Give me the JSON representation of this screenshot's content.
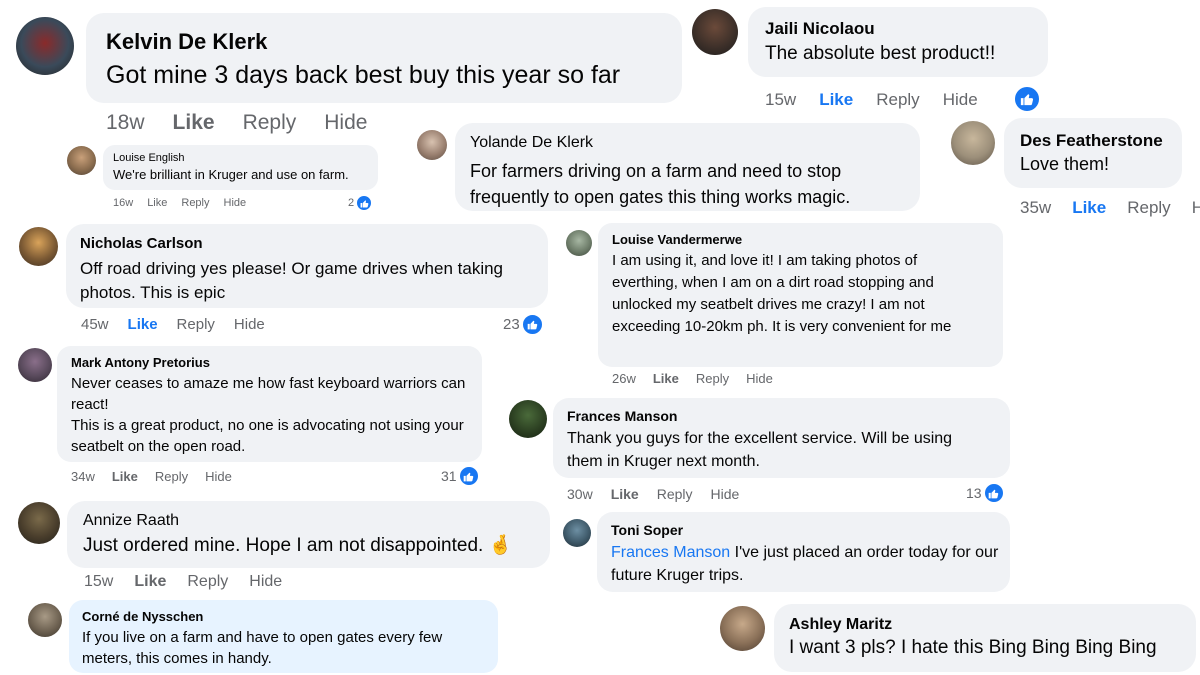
{
  "comments": [
    {
      "name": "Kelvin De Klerk",
      "text": "Got mine 3 days back best buy this year so far",
      "age": "18w",
      "like": "Like",
      "reply": "Reply",
      "hide": "Hide"
    },
    {
      "name": "Jaili Nicolaou",
      "text": "The absolute best product!!",
      "age": "15w",
      "like": "Like",
      "reply": "Reply",
      "hide": "Hide"
    },
    {
      "name": "Louise English",
      "text": "We're brilliant in Kruger and use on farm.",
      "age": "16w",
      "like": "Like",
      "reply": "Reply",
      "hide": "Hide",
      "reactions": "2"
    },
    {
      "name": "Yolande De Klerk",
      "text": "For farmers driving on a farm and need to stop frequently to open gates this thing works magic."
    },
    {
      "name": "Des Featherstone",
      "text": "Love them!",
      "age": "35w",
      "like": "Like",
      "reply": "Reply",
      "hide": "H"
    },
    {
      "name": "Nicholas Carlson",
      "text": "Off road driving yes please! Or game drives when taking photos. This is epic",
      "age": "45w",
      "like": "Like",
      "reply": "Reply",
      "hide": "Hide",
      "reactions": "23"
    },
    {
      "name": "Louise Vandermerwe",
      "text": "I am using it, and love it! I am taking photos of everthing, when I am on a dirt road stopping and unlocked my seatbelt drives me crazy! I am not exceeding 10-20km ph. It is very convenient for me",
      "age": "26w",
      "like": "Like",
      "reply": "Reply",
      "hide": "Hide"
    },
    {
      "name": "Mark Antony Pretorius",
      "text1": "Never ceases to amaze me how fast keyboard warriors can react!",
      "text2": "This is a great product, no one is advocating not using your seatbelt on the open road.",
      "age": "34w",
      "like": "Like",
      "reply": "Reply",
      "hide": "Hide",
      "reactions": "31"
    },
    {
      "name": "Frances Manson",
      "text": "Thank you guys for the excellent service. Will be using them in Kruger next month.",
      "age": "30w",
      "like": "Like",
      "reply": "Reply",
      "hide": "Hide",
      "reactions": "13"
    },
    {
      "name": "Annize Raath",
      "text": "Just ordered mine. Hope I am not disappointed. 🤞",
      "age": "15w",
      "like": "Like",
      "reply": "Reply",
      "hide": "Hide"
    },
    {
      "name": "Toni Soper",
      "tag": "Frances Manson",
      "text": " I've just placed an order today for our future Kruger trips."
    },
    {
      "name": "Corné de Nysschen",
      "text": "If you live on a farm and have to open gates every few meters, this comes in handy."
    },
    {
      "name": "Ashley Maritz",
      "text": "I want 3 pls? I hate this Bing Bing Bing Bing"
    }
  ],
  "colors": {
    "bubble": "#f0f2f5",
    "bubble_highlight": "#e7f3ff",
    "link": "#1877f2",
    "meta": "#65676b"
  }
}
